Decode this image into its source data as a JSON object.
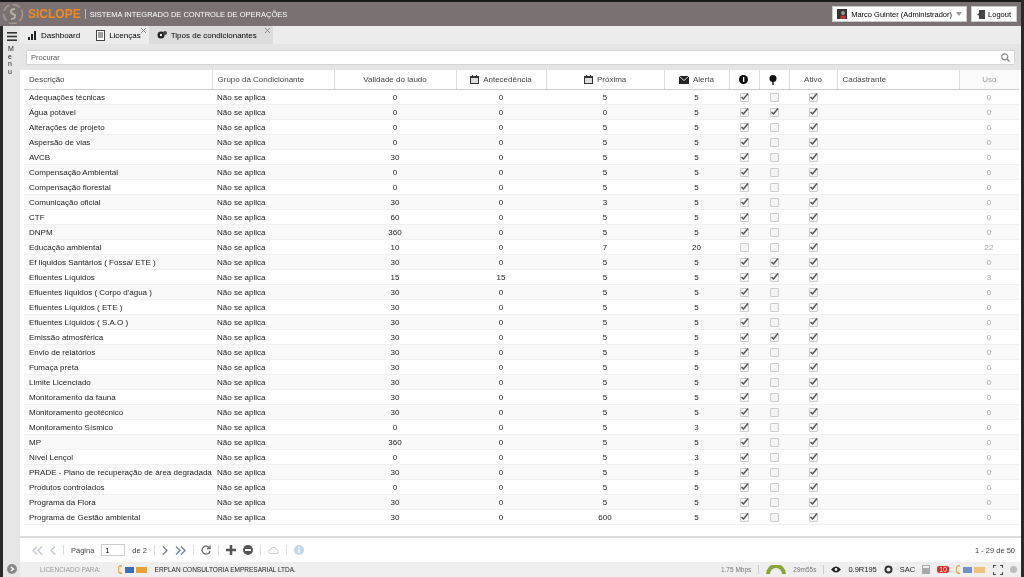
{
  "app": {
    "logo": "SICLOPE",
    "subtitle": "SISTEMA INTEGRADO DE CONTROLE DE OPERAÇÕES",
    "user": "Marco Guinter (Administrador)",
    "logout": "Logout",
    "menu_label": "Menu"
  },
  "tabs": [
    {
      "label": "Dashboard",
      "selected": false,
      "closable": false
    },
    {
      "label": "Licenças",
      "selected": false,
      "closable": true
    },
    {
      "label": "Tipos de condicionantes",
      "selected": true,
      "closable": true
    }
  ],
  "search": {
    "placeholder": "Procurar"
  },
  "table": {
    "columns": [
      "Descrição",
      "Grupo da Condicionante",
      "Validade do laudo",
      "Antecedência",
      "Próxima",
      "Alerta",
      "",
      "",
      "Ativo",
      "Cadastrante",
      "Uso"
    ],
    "rows": [
      {
        "descricao": "Adequações técnicas",
        "grupo": "Não se aplica",
        "validade": "0",
        "antecedencia": "0",
        "proxima": "5",
        "alerta": "5",
        "flag1": true,
        "flag2": false,
        "ativo": true,
        "uso": "0"
      },
      {
        "descricao": "Água potável",
        "grupo": "Não se aplica",
        "validade": "0",
        "antecedencia": "0",
        "proxima": "0",
        "alerta": "5",
        "flag1": true,
        "flag2": true,
        "ativo": true,
        "uso": "0"
      },
      {
        "descricao": "Alterações de projeto",
        "grupo": "Não se aplica",
        "validade": "0",
        "antecedencia": "0",
        "proxima": "5",
        "alerta": "5",
        "flag1": true,
        "flag2": false,
        "ativo": true,
        "uso": "0"
      },
      {
        "descricao": "Aspersão de vias",
        "grupo": "Não se aplica",
        "validade": "0",
        "antecedencia": "0",
        "proxima": "5",
        "alerta": "5",
        "flag1": true,
        "flag2": false,
        "ativo": true,
        "uso": "0"
      },
      {
        "descricao": "AVCB",
        "grupo": "Não se aplica",
        "validade": "30",
        "antecedencia": "0",
        "proxima": "5",
        "alerta": "5",
        "flag1": true,
        "flag2": false,
        "ativo": true,
        "uso": "0"
      },
      {
        "descricao": "Compensação Ambiental",
        "grupo": "Não se aplica",
        "validade": "0",
        "antecedencia": "0",
        "proxima": "5",
        "alerta": "5",
        "flag1": true,
        "flag2": false,
        "ativo": true,
        "uso": "0"
      },
      {
        "descricao": "Compensação florestal",
        "grupo": "Não se aplica",
        "validade": "0",
        "antecedencia": "0",
        "proxima": "5",
        "alerta": "5",
        "flag1": true,
        "flag2": false,
        "ativo": true,
        "uso": "0"
      },
      {
        "descricao": "Comunicação oficial",
        "grupo": "Não se aplica",
        "validade": "30",
        "antecedencia": "0",
        "proxima": "3",
        "alerta": "5",
        "flag1": true,
        "flag2": false,
        "ativo": true,
        "uso": "0"
      },
      {
        "descricao": "CTF",
        "grupo": "Não se aplica",
        "validade": "60",
        "antecedencia": "0",
        "proxima": "5",
        "alerta": "5",
        "flag1": true,
        "flag2": false,
        "ativo": true,
        "uso": "0"
      },
      {
        "descricao": "DNPM",
        "grupo": "Não se aplica",
        "validade": "360",
        "antecedencia": "0",
        "proxima": "5",
        "alerta": "5",
        "flag1": true,
        "flag2": false,
        "ativo": true,
        "uso": "0"
      },
      {
        "descricao": "Educação ambiental",
        "grupo": "Não se aplica",
        "validade": "10",
        "antecedencia": "0",
        "proxima": "7",
        "alerta": "20",
        "flag1": false,
        "flag2": false,
        "ativo": true,
        "uso": "22"
      },
      {
        "descricao": "Ef liquidos Santários ( Fossa/ ETE )",
        "grupo": "Não se aplica",
        "validade": "30",
        "antecedencia": "0",
        "proxima": "5",
        "alerta": "5",
        "flag1": true,
        "flag2": true,
        "ativo": true,
        "uso": "0"
      },
      {
        "descricao": "Efluentes Líquidos",
        "grupo": "Não se aplica",
        "validade": "15",
        "antecedencia": "15",
        "proxima": "5",
        "alerta": "5",
        "flag1": true,
        "flag2": true,
        "ativo": true,
        "uso": "3"
      },
      {
        "descricao": "Efluentes líquidos ( Corpo d'agua )",
        "grupo": "Não se aplica",
        "validade": "30",
        "antecedencia": "0",
        "proxima": "5",
        "alerta": "5",
        "flag1": true,
        "flag2": false,
        "ativo": true,
        "uso": "0"
      },
      {
        "descricao": "Efluentes Líquidos ( ETE )",
        "grupo": "Não se aplica",
        "validade": "30",
        "antecedencia": "0",
        "proxima": "5",
        "alerta": "5",
        "flag1": true,
        "flag2": false,
        "ativo": true,
        "uso": "0"
      },
      {
        "descricao": "Efluentes Líquidos ( S.A.O )",
        "grupo": "Não se aplica",
        "validade": "30",
        "antecedencia": "0",
        "proxima": "5",
        "alerta": "5",
        "flag1": true,
        "flag2": false,
        "ativo": true,
        "uso": "0"
      },
      {
        "descricao": "Emissão atmosférica",
        "grupo": "Não se aplica",
        "validade": "30",
        "antecedencia": "0",
        "proxima": "5",
        "alerta": "5",
        "flag1": true,
        "flag2": true,
        "ativo": true,
        "uso": "0"
      },
      {
        "descricao": "Envio de relatórios",
        "grupo": "Não se aplica",
        "validade": "30",
        "antecedencia": "0",
        "proxima": "5",
        "alerta": "5",
        "flag1": true,
        "flag2": false,
        "ativo": true,
        "uso": "0"
      },
      {
        "descricao": "Fumaça preta",
        "grupo": "Não se aplica",
        "validade": "30",
        "antecedencia": "0",
        "proxima": "5",
        "alerta": "5",
        "flag1": true,
        "flag2": false,
        "ativo": true,
        "uso": "0"
      },
      {
        "descricao": "Limite Licenciado",
        "grupo": "Não se aplica",
        "validade": "30",
        "antecedencia": "0",
        "proxima": "5",
        "alerta": "5",
        "flag1": true,
        "flag2": false,
        "ativo": true,
        "uso": "0"
      },
      {
        "descricao": "Monitoramento da fauna",
        "grupo": "Não se aplica",
        "validade": "30",
        "antecedencia": "0",
        "proxima": "5",
        "alerta": "5",
        "flag1": true,
        "flag2": false,
        "ativo": true,
        "uso": "0"
      },
      {
        "descricao": "Monitoramento geotécnico",
        "grupo": "Não se aplica",
        "validade": "30",
        "antecedencia": "0",
        "proxima": "5",
        "alerta": "5",
        "flag1": true,
        "flag2": false,
        "ativo": true,
        "uso": "0"
      },
      {
        "descricao": "Monitoramento Sísmico",
        "grupo": "Não se aplica",
        "validade": "0",
        "antecedencia": "0",
        "proxima": "5",
        "alerta": "3",
        "flag1": true,
        "flag2": false,
        "ativo": true,
        "uso": "0"
      },
      {
        "descricao": "MP",
        "grupo": "Não se aplica",
        "validade": "360",
        "antecedencia": "0",
        "proxima": "5",
        "alerta": "5",
        "flag1": true,
        "flag2": false,
        "ativo": true,
        "uso": "0"
      },
      {
        "descricao": "Nível Lençol",
        "grupo": "Não se aplica",
        "validade": "0",
        "antecedencia": "0",
        "proxima": "5",
        "alerta": "3",
        "flag1": true,
        "flag2": false,
        "ativo": true,
        "uso": "0"
      },
      {
        "descricao": "PRADE - Plano de recuperação de área degradada",
        "grupo": "Não se aplica",
        "validade": "30",
        "antecedencia": "0",
        "proxima": "5",
        "alerta": "5",
        "flag1": true,
        "flag2": false,
        "ativo": true,
        "uso": "0"
      },
      {
        "descricao": "Produtos controlados",
        "grupo": "Não se aplica",
        "validade": "0",
        "antecedencia": "0",
        "proxima": "5",
        "alerta": "5",
        "flag1": true,
        "flag2": false,
        "ativo": true,
        "uso": "0"
      },
      {
        "descricao": "Programa da Flora",
        "grupo": "Não se aplica",
        "validade": "30",
        "antecedencia": "0",
        "proxima": "5",
        "alerta": "5",
        "flag1": true,
        "flag2": false,
        "ativo": true,
        "uso": "0"
      },
      {
        "descricao": "Programa de Gestão ambiental",
        "grupo": "Não se aplica",
        "validade": "30",
        "antecedencia": "0",
        "proxima": "600",
        "alerta": "5",
        "flag1": true,
        "flag2": false,
        "ativo": true,
        "uso": "0"
      }
    ]
  },
  "pager": {
    "page_label": "Página",
    "page": "1",
    "of": "de 2",
    "summary": "1 - 29 de 50"
  },
  "footer": {
    "licensed_label": "LICENCIADO PARA:",
    "company": "ERPLAN CONSULTORIA EMPRESARIAL LTDA.",
    "speed": "1.75 Mbps",
    "session": "29m55s",
    "version": "0.9R195",
    "support": "SAC",
    "notifications": "10"
  }
}
